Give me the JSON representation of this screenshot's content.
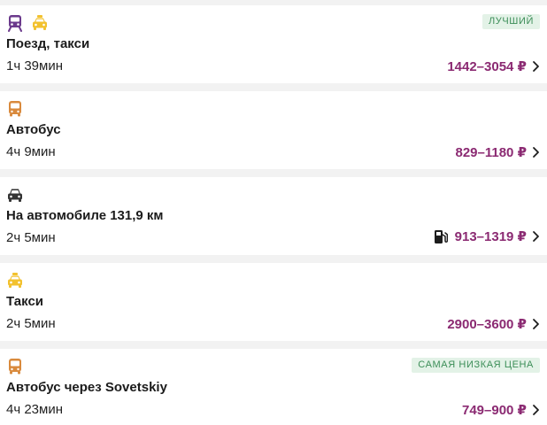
{
  "routes": [
    {
      "icons": [
        "train-icon",
        "taxi-icon"
      ],
      "title": "Поезд, такси",
      "duration": "1ч 39мин",
      "price": "1442–3054 ₽",
      "badge": "ЛУЧШИЙ"
    },
    {
      "icons": [
        "bus-icon"
      ],
      "title": "Автобус",
      "duration": "4ч 9мин",
      "price": "829–1180 ₽"
    },
    {
      "icons": [
        "car-icon"
      ],
      "title": "На автомобиле 131,9 км",
      "duration": "2ч 5мин",
      "price": "913–1319 ₽",
      "extra_icon": "fuel-pump-icon"
    },
    {
      "icons": [
        "taxi-icon"
      ],
      "title": "Такси",
      "duration": "2ч 5мин",
      "price": "2900–3600 ₽"
    },
    {
      "icons": [
        "bus-icon"
      ],
      "title": "Автобус через Sovetskiy",
      "duration": "4ч 23мин",
      "price": "749–900 ₽",
      "badge": "САМАЯ НИЗКАЯ ЦЕНА"
    }
  ],
  "colors": {
    "price": "#8b2a72",
    "badge_bg": "#e3f2e7",
    "badge_text": "#3c8e58",
    "train": "#6b3a8c",
    "taxi": "#f2c12e",
    "bus": "#d98a3d",
    "car": "#333333"
  }
}
